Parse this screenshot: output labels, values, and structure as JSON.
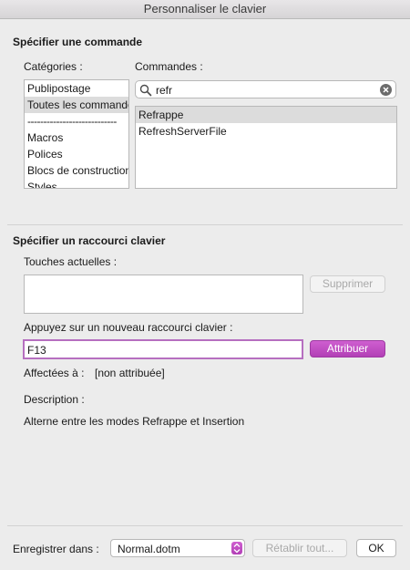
{
  "window": {
    "title": "Personnaliser le clavier"
  },
  "command_section": {
    "title": "Spécifier une commande",
    "categories_label": "Catégories :",
    "commands_label": "Commandes :",
    "categories": [
      "Publipostage",
      "Toutes les commandes",
      "----------------------------",
      "Macros",
      "Polices",
      "Blocs de construction",
      "Styles"
    ],
    "selected_category_index": 1,
    "search": {
      "value": "refr",
      "icon": "magnifier-icon",
      "clear_icon": "clear-icon"
    },
    "commands": [
      "Refrappe",
      "RefreshServerFile"
    ],
    "selected_command_index": 0
  },
  "shortcut_section": {
    "title": "Spécifier un raccourci clavier",
    "current_keys_label": "Touches actuelles :",
    "remove_button": "Supprimer",
    "new_shortcut_label": "Appuyez sur un nouveau raccourci clavier :",
    "new_shortcut_value": "F13",
    "assign_button": "Attribuer",
    "assigned_label": "Affectées à :",
    "assigned_value": "[non attribuée]",
    "description_label": "Description :",
    "description_value": "Alterne entre les modes Refrappe et Insertion"
  },
  "footer": {
    "save_in_label": "Enregistrer dans :",
    "save_in_value": "Normal.dotm",
    "reset_button": "Rétablir tout...",
    "ok_button": "OK"
  },
  "colors": {
    "accent": "#b23fb6",
    "background": "#ececec"
  }
}
